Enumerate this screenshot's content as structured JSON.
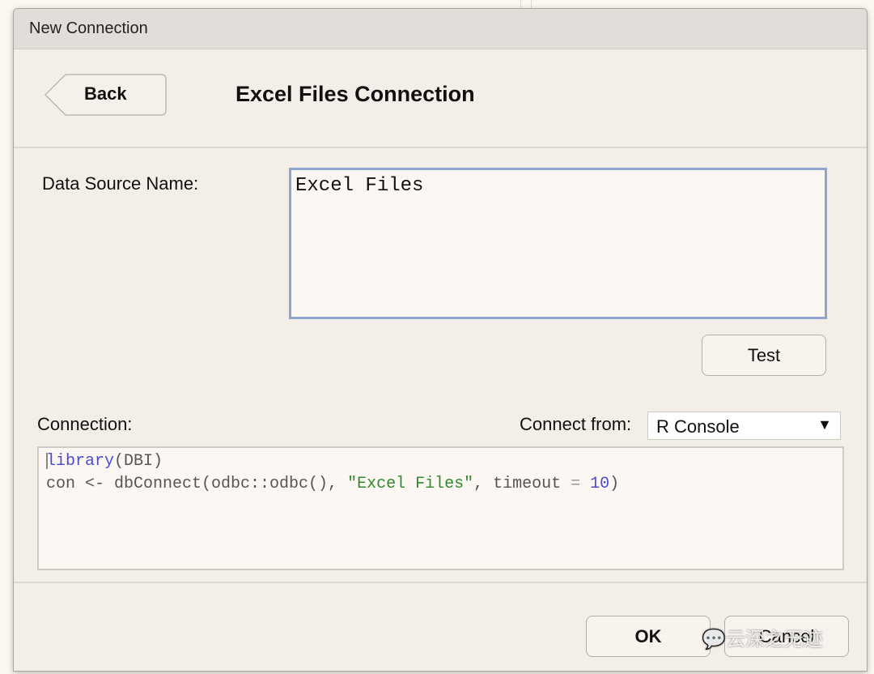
{
  "dialog": {
    "title": "New Connection",
    "back_label": "Back",
    "heading": "Excel Files Connection",
    "dsn_label": "Data Source Name:",
    "dsn_value": "Excel Files",
    "test_label": "Test",
    "connection_label": "Connection:",
    "connect_from_label": "Connect from:",
    "connect_from_value": "R Console",
    "code": {
      "line1_fn": "library",
      "line1_rest": "(DBI)",
      "line2_a": "con <- dbConnect(odbc::odbc(), ",
      "line2_str": "\"Excel Files\"",
      "line2_b": ", timeout ",
      "line2_eq": "=",
      "line2_num": "10",
      "line2_end": ")"
    },
    "ok_label": "OK",
    "cancel_label": "Cancel"
  },
  "watermark": "云深之无迹",
  "colors": {
    "input_border": "#8ea6cf",
    "keyword": "#4b4bd0",
    "string": "#2e8b2e"
  }
}
